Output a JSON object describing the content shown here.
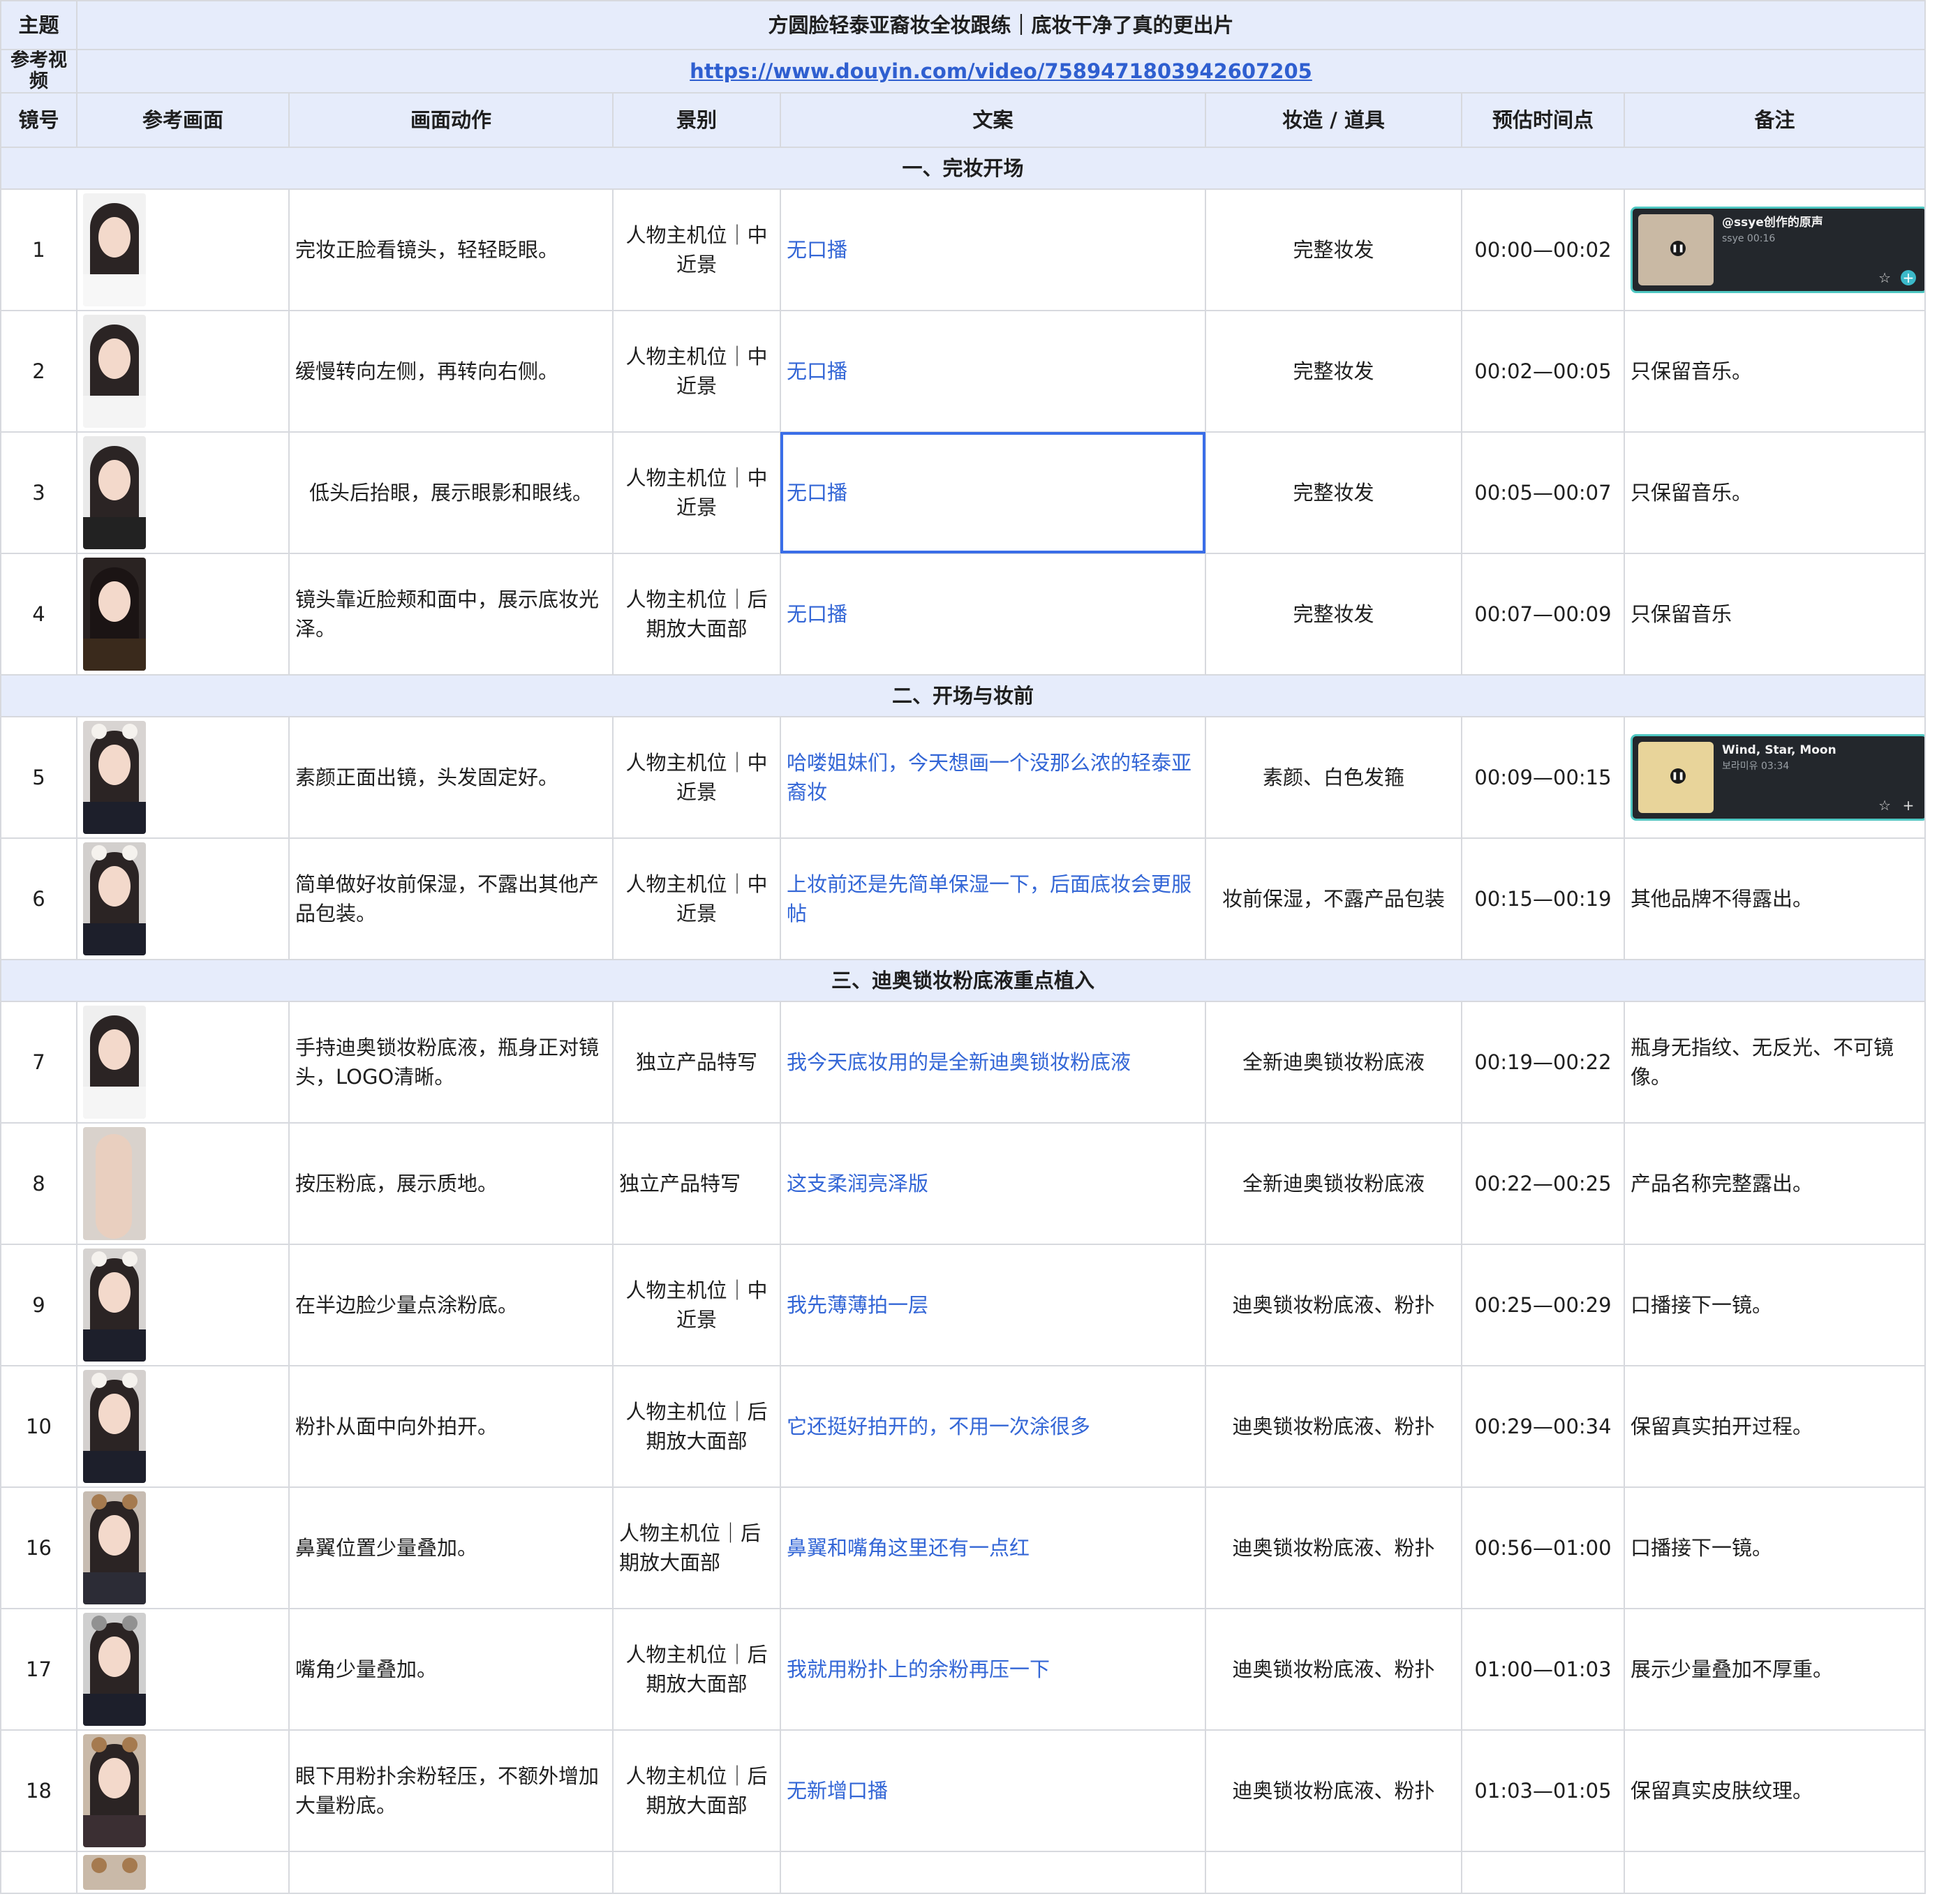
{
  "header": {
    "topic_label": "主题",
    "topic_value": "方圆脸轻泰亚裔妆全妆跟练｜底妆干净了真的更出片",
    "ref_label": "参考视频",
    "ref_url": "https://www.douyin.com/video/7589471803942607205"
  },
  "columns": [
    "镜号",
    "参考画面",
    "画面动作",
    "景别",
    "文案",
    "妆造 / 道具",
    "预估时间点",
    "备注"
  ],
  "sections": {
    "s1": "一、完妆开场",
    "s2": "二、开场与妆前",
    "s3": "三、迪奥锁妆粉底液重点植入"
  },
  "music": {
    "m1_title": "@ssye创作的原声",
    "m1_sub": "ssye 00:16",
    "m2_title": "Wind, Star, Moon",
    "m2_sub": "보라미유 03:34"
  },
  "rows": [
    {
      "no": "1",
      "action": "完妆正脸看镜头，轻轻眨眼。",
      "shot": "人物主机位｜中近景",
      "copy": "无口播",
      "props": "完整妆发",
      "time": "00:00—00:02",
      "note": ""
    },
    {
      "no": "2",
      "action": "缓慢转向左侧，再转向右侧。",
      "shot": "人物主机位｜中近景",
      "copy": "无口播",
      "props": "完整妆发",
      "time": "00:02—00:05",
      "note": "只保留音乐。"
    },
    {
      "no": "3",
      "action": "低头后抬眼，展示眼影和眼线。",
      "shot": "人物主机位｜中近景",
      "copy": "无口播",
      "props": "完整妆发",
      "time": "00:05—00:07",
      "note": "只保留音乐。"
    },
    {
      "no": "4",
      "action": "镜头靠近脸颊和面中，展示底妆光泽。",
      "shot": "人物主机位｜后期放大面部",
      "copy": "无口播",
      "props": "完整妆发",
      "time": "00:07—00:09",
      "note": "只保留音乐"
    },
    {
      "no": "5",
      "action": "素颜正面出镜，头发固定好。",
      "shot": "人物主机位｜中近景",
      "copy": "哈喽姐妹们，今天想画一个没那么浓的轻泰亚裔妆",
      "props": "素颜、白色发箍",
      "time": "00:09—00:15",
      "note": ""
    },
    {
      "no": "6",
      "action": "简单做好妆前保湿，不露出其他产品包装。",
      "shot": "人物主机位｜中近景",
      "copy": "上妆前还是先简单保湿一下，后面底妆会更服帖",
      "props": "妆前保湿，不露产品包装",
      "time": "00:15—00:19",
      "note": "其他品牌不得露出。"
    },
    {
      "no": "7",
      "action": "手持迪奥锁妆粉底液，瓶身正对镜头，LOGO清晰。",
      "shot": "独立产品特写",
      "copy": "我今天底妆用的是全新迪奥锁妆粉底液",
      "props": "全新迪奥锁妆粉底液",
      "time": "00:19—00:22",
      "note": "瓶身无指纹、无反光、不可镜像。"
    },
    {
      "no": "8",
      "action": "按压粉底，展示质地。",
      "shot": "独立产品特写",
      "copy": "这支柔润亮泽版",
      "props": "全新迪奥锁妆粉底液",
      "time": "00:22—00:25",
      "note": "产品名称完整露出。"
    },
    {
      "no": "9",
      "action": "在半边脸少量点涂粉底。",
      "shot": "人物主机位｜中近景",
      "copy": "我先薄薄拍一层",
      "props": "迪奥锁妆粉底液、粉扑",
      "time": "00:25—00:29",
      "note": "口播接下一镜。"
    },
    {
      "no": "10",
      "action": "粉扑从面中向外拍开。",
      "shot": "人物主机位｜后期放大面部",
      "copy": "它还挺好拍开的，不用一次涂很多",
      "props": "迪奥锁妆粉底液、粉扑",
      "time": "00:29—00:34",
      "note": "保留真实拍开过程。"
    },
    {
      "no": "16",
      "action": "鼻翼位置少量叠加。",
      "shot": "人物主机位｜后期放大面部",
      "copy": "鼻翼和嘴角这里还有一点红",
      "props": "迪奥锁妆粉底液、粉扑",
      "time": "00:56—01:00",
      "note": "口播接下一镜。"
    },
    {
      "no": "17",
      "action": "嘴角少量叠加。",
      "shot": "人物主机位｜后期放大面部",
      "copy": "我就用粉扑上的余粉再压一下",
      "props": "迪奥锁妆粉底液、粉扑",
      "time": "01:00—01:03",
      "note": "展示少量叠加不厚重。"
    },
    {
      "no": "18",
      "action": "眼下用粉扑余粉轻压，不额外增加大量粉底。",
      "shot": "人物主机位｜后期放大面部",
      "copy": "无新增口播",
      "props": "迪奥锁妆粉底液、粉扑",
      "time": "01:03—01:05",
      "note": "保留真实皮肤纹理。"
    }
  ],
  "colors": {
    "header_bg": "#e6ecfb",
    "link": "#3366d6",
    "border": "#d7d9de",
    "music_accent": "#4fc7c2"
  }
}
